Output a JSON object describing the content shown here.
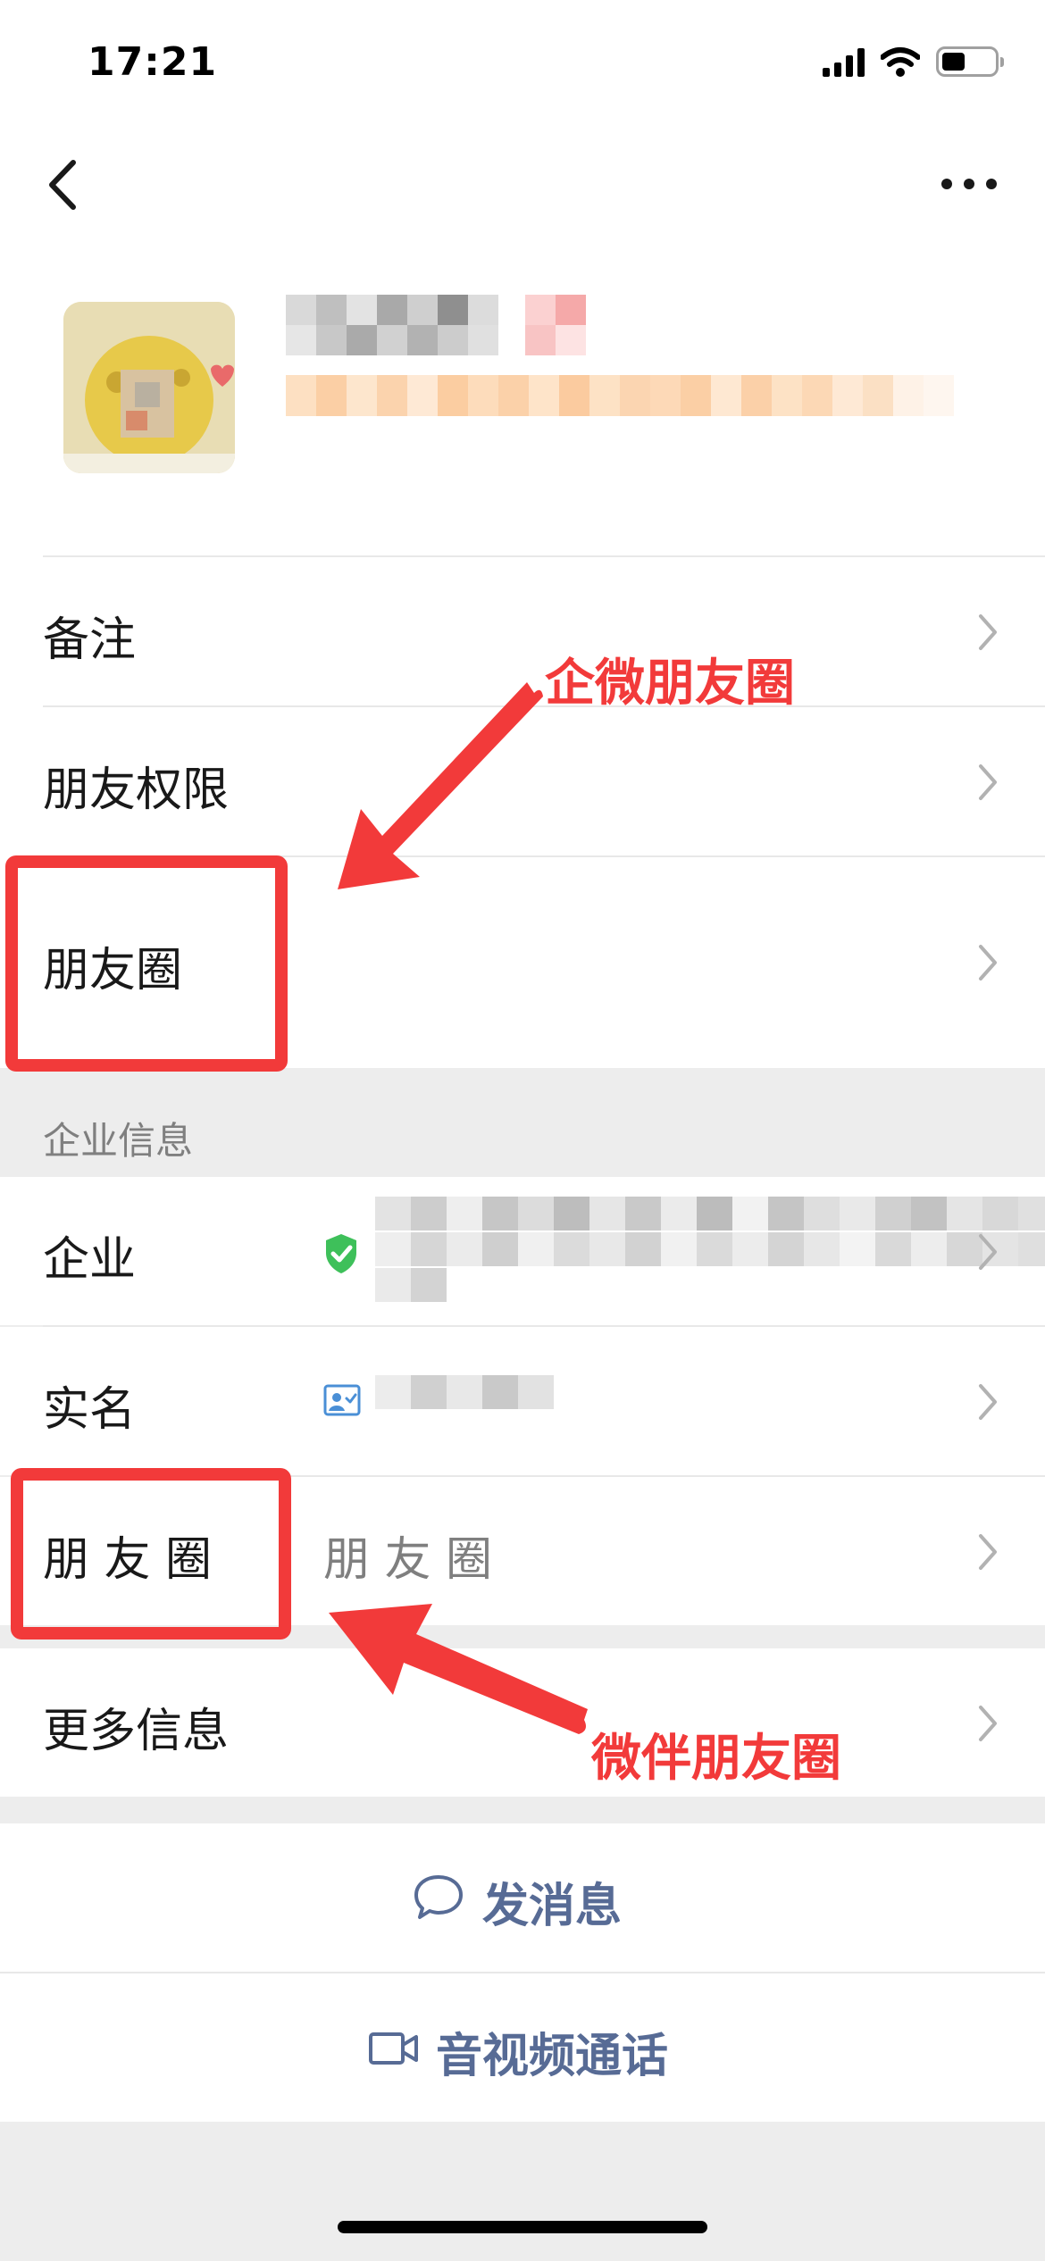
{
  "status_bar": {
    "time": "17:21"
  },
  "rows": {
    "remark": "备注",
    "friend_permission": "朋友权限",
    "moments": "朋友圈",
    "section_company": "企业信息",
    "company": "企业",
    "real_name": "实名",
    "moments_spaced": "朋 友 圈",
    "moments_value_spaced": "朋 友 圈",
    "more_info": "更多信息"
  },
  "actions": {
    "send_message": "发消息",
    "av_call": "音视频通话"
  },
  "annotations": {
    "qiwei_moments": "企微朋友圈",
    "weiban_moments": "微伴朋友圈",
    "color": "#f23a3a"
  },
  "colors": {
    "link_blue": "#576b95",
    "verified_green": "#3ec05a",
    "background_gray": "#ededed"
  }
}
